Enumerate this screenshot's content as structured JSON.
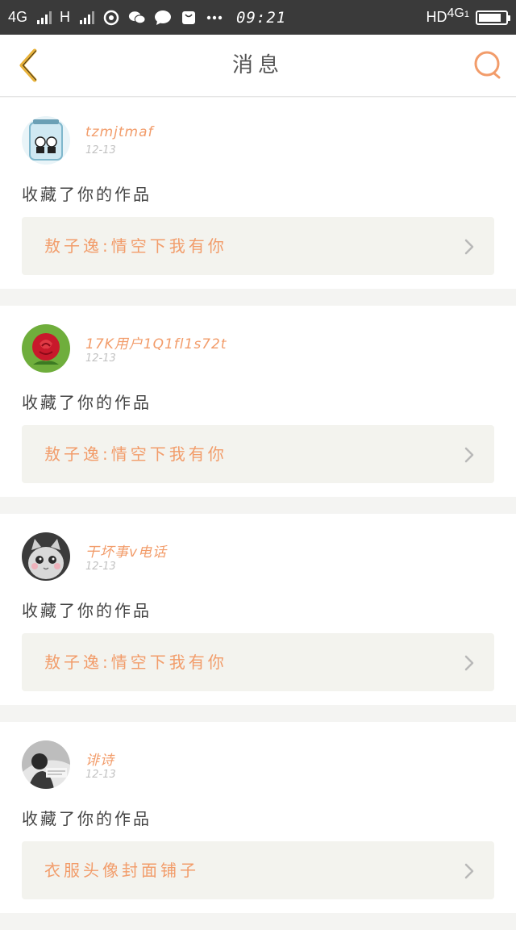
{
  "status_bar": {
    "network1": "4G",
    "network2": "H",
    "time": "09:21",
    "hd": "HD",
    "network_right": "4G",
    "network_right_sub": "1",
    "battery_level": 0.85
  },
  "header": {
    "title": "消息",
    "back_icon": "chevron-left-icon",
    "search_icon": "search-icon"
  },
  "messages": [
    {
      "username": "tzmjtmaf",
      "date": "12-13",
      "action": "收藏了你的作品",
      "work_title": "敖子逸:情空下我有你"
    },
    {
      "username": "17K用户1Q1fl1s72t",
      "date": "12-13",
      "action": "收藏了你的作品",
      "work_title": "敖子逸:情空下我有你"
    },
    {
      "username": "干坏事v电话",
      "date": "12-13",
      "action": "收藏了你的作品",
      "work_title": "敖子逸:情空下我有你"
    },
    {
      "username": "诽诗",
      "date": "12-13",
      "action": "收藏了你的作品",
      "work_title": "衣服头像封面铺子"
    }
  ],
  "colors": {
    "accent": "#f29c6a",
    "back_icon": "#e8b23a",
    "status_bar": "#3a3a3a",
    "link_bg": "#f3f3ee"
  }
}
